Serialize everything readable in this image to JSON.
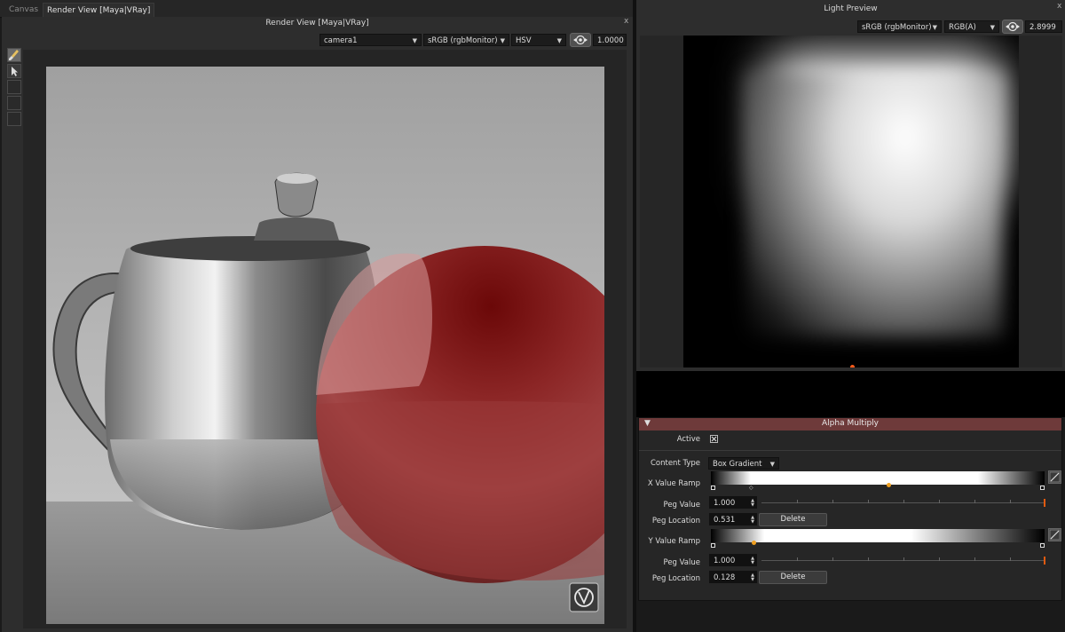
{
  "tabs": [
    {
      "label": "Canvas",
      "active": false
    },
    {
      "label": "Render View [Maya|VRay]",
      "active": true
    }
  ],
  "render_view": {
    "title": "Render View [Maya|VRay]",
    "close_label": "x",
    "camera": "camera1",
    "color_space": "sRGB (rgbMonitor)",
    "display_mode": "HSV",
    "exposure": "1.0000",
    "tools": [
      "brush-tool-icon",
      "select-arrow-icon",
      "tool-slot-3",
      "tool-slot-4",
      "tool-slot-5"
    ],
    "scene_colors": {
      "sphere": "#8a2020",
      "floor": "#8c8c8c",
      "wall": "#b0b0b0"
    }
  },
  "light_preview": {
    "title": "Light Preview",
    "close_label": "x",
    "color_space": "sRGB (rgbMonitor)",
    "channels": "RGB(A)",
    "exposure": "2.8999"
  },
  "alpha_multiply": {
    "header": "Alpha Multiply",
    "accent_color": "#6e3a3a",
    "active_label": "Active",
    "active_checked": true,
    "content_type_label": "Content Type",
    "content_type": "Box Gradient",
    "x_ramp": {
      "label": "X Value Ramp",
      "peg_value_label": "Peg Value",
      "peg_value": "1.000",
      "peg_location_label": "Peg Location",
      "peg_location": "0.531",
      "delete_label": "Delete",
      "selected_peg_position": 0.531,
      "peg_value_fraction": 1.0
    },
    "y_ramp": {
      "label": "Y Value Ramp",
      "peg_value_label": "Peg Value",
      "peg_value": "1.000",
      "peg_location_label": "Peg Location",
      "peg_location": "0.128",
      "delete_label": "Delete",
      "selected_peg_position": 0.128,
      "peg_value_fraction": 1.0
    }
  }
}
